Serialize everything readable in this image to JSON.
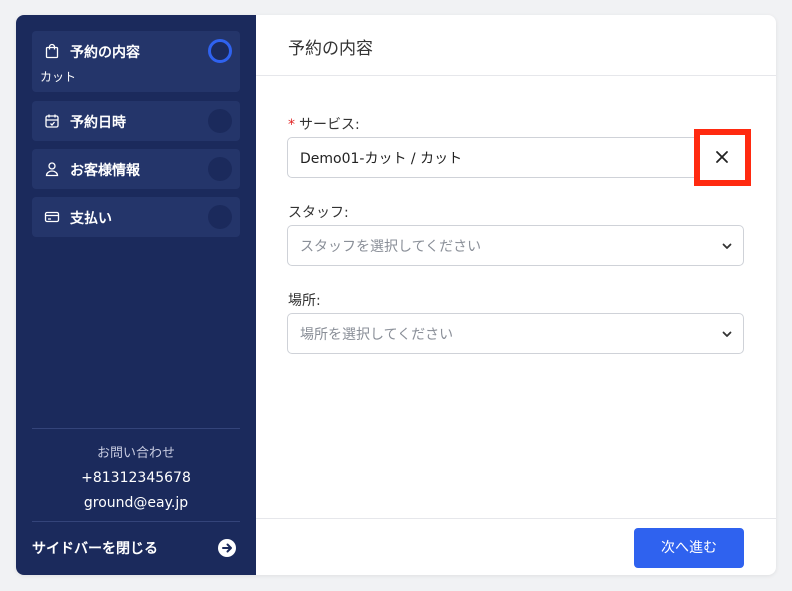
{
  "sidebar": {
    "steps": [
      {
        "label": "予約の内容",
        "sub": "カット",
        "icon": "shopping-bag-icon",
        "active": true
      },
      {
        "label": "予約日時",
        "icon": "calendar-icon"
      },
      {
        "label": "お客様情報",
        "icon": "user-icon"
      },
      {
        "label": "支払い",
        "icon": "credit-card-icon"
      }
    ],
    "contact": {
      "heading": "お問い合わせ",
      "phone": "+81312345678",
      "email": "ground@eay.jp"
    },
    "close_label": "サイドバーを閉じる"
  },
  "main": {
    "title": "予約の内容",
    "service": {
      "label": "サービス:",
      "required_mark": "*",
      "value": "Demo01-カット / カット"
    },
    "staff": {
      "label": "スタッフ:",
      "placeholder": "スタッフを選択してください"
    },
    "location": {
      "label": "場所:",
      "placeholder": "場所を選択してください"
    },
    "next_label": "次へ進む"
  },
  "colors": {
    "sidebar_bg": "#1b2a5c",
    "step_bg": "#24356a",
    "accent": "#2f62ef",
    "highlight": "#ff2a10"
  }
}
